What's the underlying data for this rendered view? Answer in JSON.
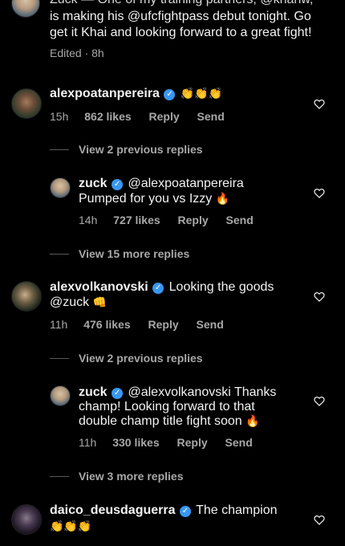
{
  "top_comment": {
    "partial_line": "Zuck — One of my training partners, @khanw,",
    "line1": "is making his @ufcfightpass debut tonight. Go",
    "line2": "get it Khai and looking forward to a great fight!",
    "edited": "Edited · 8h"
  },
  "comments": [
    {
      "username": "alexpoatanpereira",
      "text": "",
      "emoji": "👏👏👏",
      "time": "15h",
      "likes": "862 likes",
      "reply": "Reply",
      "send": "Send",
      "view_replies": "View 2 previous replies",
      "reply_item": {
        "username": "zuck",
        "mention": "@alexpoatanpereira",
        "text": "Pumped for you vs Izzy",
        "emoji": "🔥",
        "time": "14h",
        "likes": "727 likes",
        "reply": "Reply",
        "send": "Send"
      },
      "more_replies": "View 15 more replies"
    },
    {
      "username": "alexvolkanovski",
      "text_line1": "Looking the goods",
      "text_line2": "@zuck",
      "emoji": "👊",
      "time": "11h",
      "likes": "476 likes",
      "reply": "Reply",
      "send": "Send",
      "view_replies": "View 2 previous replies",
      "reply_item": {
        "username": "zuck",
        "text_line1": "@alexvolkanovski Thanks",
        "text_line2": "champ! Looking forward to that",
        "text_line3": "double champ title fight soon",
        "emoji": "🔥",
        "time": "11h",
        "likes": "330 likes",
        "reply": "Reply",
        "send": "Send"
      },
      "more_replies": "View 3 more replies"
    },
    {
      "username": "daico_deusdaguerra",
      "text": "The champion",
      "emoji": "👏👏👏"
    }
  ],
  "icons": {
    "verified": "verified-badge-icon",
    "heart": "heart-outline-icon"
  },
  "colors": {
    "background": "#000000",
    "text": "#f5f5f5",
    "muted": "#a8a8a8",
    "verified": "#3897f0"
  }
}
